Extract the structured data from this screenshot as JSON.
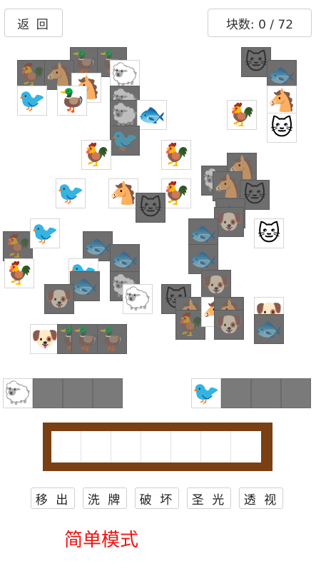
{
  "header": {
    "back_label": "返 回",
    "count_label": "块数: 0 / 72"
  },
  "icons": {
    "rooster": "🐓",
    "horse": "🐴",
    "duck": "🦆",
    "sheep": "🐑",
    "cat": "🐱",
    "fish": "🐟",
    "bird": "🐦",
    "dog": "🐶"
  },
  "tools": [
    "移 出",
    "洗 牌",
    "破 坏",
    "圣 光",
    "透 视"
  ],
  "side_stacks": {
    "left_top": "sheep",
    "right_top": "bird"
  },
  "mode_label": "简单模式"
}
